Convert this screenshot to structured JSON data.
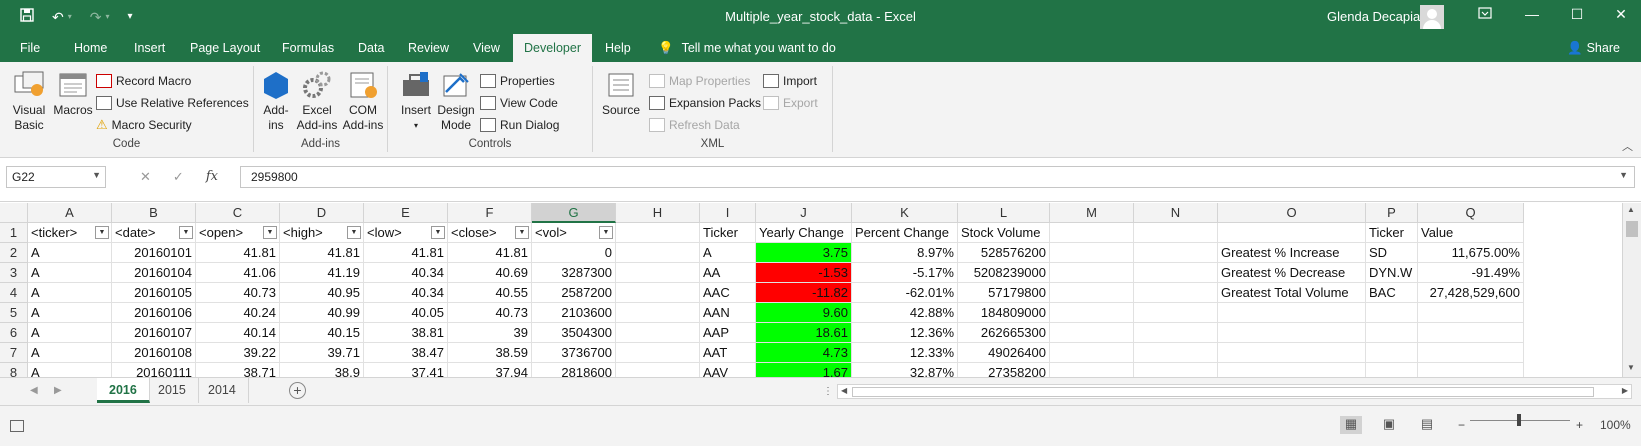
{
  "titlebar": {
    "doc_title": "Multiple_year_stock_data  -  Excel",
    "user": "Glenda Decapia",
    "save_icon": "save-icon",
    "undo_icon": "undo-icon",
    "redo_icon": "redo-icon",
    "customize_icon": "customize-qat-icon",
    "ribbon_display_icon": "ribbon-display-options-icon",
    "minimize_glyph": "—",
    "maximize_glyph": "☐",
    "close_glyph": "✕"
  },
  "menu": {
    "tabs": [
      "File",
      "Home",
      "Insert",
      "Page Layout",
      "Formulas",
      "Data",
      "Review",
      "View",
      "Developer",
      "Help"
    ],
    "active": "Developer",
    "tell_me": "Tell me what you want to do",
    "share": "Share"
  },
  "ribbon": {
    "code": {
      "label": "Code",
      "visual_basic": [
        "Visual",
        "Basic"
      ],
      "macros": "Macros",
      "record_macro": "Record Macro",
      "relative_refs": "Use Relative References",
      "macro_security": "Macro Security"
    },
    "addins": {
      "label": "Add-ins",
      "addins": [
        "Add-",
        "ins"
      ],
      "excel_addins": [
        "Excel",
        "Add-ins"
      ],
      "com_addins": [
        "COM",
        "Add-ins"
      ]
    },
    "controls": {
      "label": "Controls",
      "insert": "Insert",
      "design_mode": [
        "Design",
        "Mode"
      ],
      "properties": "Properties",
      "view_code": "View Code",
      "run_dialog": "Run Dialog"
    },
    "xml": {
      "label": "XML",
      "source": "Source",
      "map_properties": "Map Properties",
      "expansion_packs": "Expansion Packs",
      "refresh_data": "Refresh Data",
      "import": "Import",
      "export": "Export"
    }
  },
  "formula_bar": {
    "name_box": "G22",
    "cancel_glyph": "✕",
    "enter_glyph": "✓",
    "fx": "fx",
    "value": "2959800"
  },
  "grid": {
    "columns": [
      "A",
      "B",
      "C",
      "D",
      "E",
      "F",
      "G",
      "H",
      "I",
      "J",
      "K",
      "L",
      "M",
      "N",
      "O",
      "P",
      "Q"
    ],
    "selected_column": "G",
    "rows": [
      [
        "<ticker>",
        "<date>",
        "<open>",
        "<high>",
        "<low>",
        "<close>",
        "<vol>",
        "",
        "Ticker",
        "Yearly Change",
        "Percent Change",
        "Stock Volume",
        "",
        "",
        "",
        "Ticker",
        "Value"
      ],
      [
        "A",
        "20160101",
        "41.81",
        "41.81",
        "41.81",
        "41.81",
        "0",
        "",
        "A",
        "3.75",
        "8.97%",
        "528576200",
        "",
        "",
        "Greatest % Increase",
        "SD",
        "11,675.00%"
      ],
      [
        "A",
        "20160104",
        "41.06",
        "41.19",
        "40.34",
        "40.69",
        "3287300",
        "",
        "AA",
        "-1.53",
        "-5.17%",
        "5208239000",
        "",
        "",
        "Greatest % Decrease",
        "DYN.W",
        "-91.49%"
      ],
      [
        "A",
        "20160105",
        "40.73",
        "40.95",
        "40.34",
        "40.55",
        "2587200",
        "",
        "AAC",
        "-11.82",
        "-62.01%",
        "57179800",
        "",
        "",
        "Greatest Total Volume",
        "BAC",
        "27,428,529,600"
      ],
      [
        "A",
        "20160106",
        "40.24",
        "40.99",
        "40.05",
        "40.73",
        "2103600",
        "",
        "AAN",
        "9.60",
        "42.88%",
        "184809000",
        "",
        "",
        "",
        "",
        ""
      ],
      [
        "A",
        "20160107",
        "40.14",
        "40.15",
        "38.81",
        "39",
        "3504300",
        "",
        "AAP",
        "18.61",
        "12.36%",
        "262665300",
        "",
        "",
        "",
        "",
        ""
      ],
      [
        "A",
        "20160108",
        "39.22",
        "39.71",
        "38.47",
        "38.59",
        "3736700",
        "",
        "AAT",
        "4.73",
        "12.33%",
        "49026400",
        "",
        "",
        "",
        "",
        ""
      ],
      [
        "A",
        "20160111",
        "38.71",
        "38.9",
        "37.41",
        "37.94",
        "2818600",
        "",
        "AAV",
        "1.67",
        "32.87%",
        "27358200",
        "",
        "",
        "",
        "",
        ""
      ]
    ],
    "yearly_change_colors": {
      "positive": "#00ff00",
      "negative": "#ff0000"
    }
  },
  "sheets": {
    "tabs": [
      "2016",
      "2015",
      "2014"
    ],
    "active": "2016",
    "add_glyph": "+"
  },
  "status": {
    "zoom": "100%",
    "zoom_out": "−",
    "zoom_in": "+",
    "accent_color": "#217346"
  }
}
